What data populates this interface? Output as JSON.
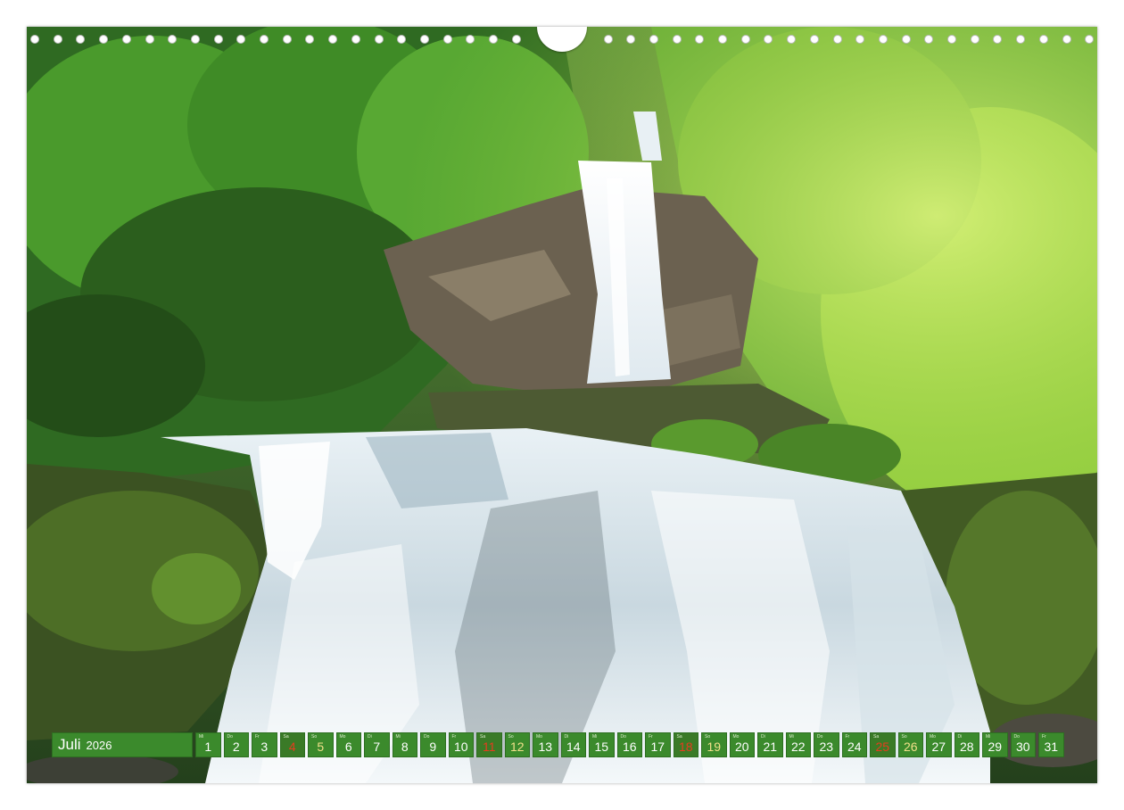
{
  "calendar": {
    "month": "Juli",
    "year": "2026",
    "days": [
      {
        "n": "1",
        "wd": "Mi",
        "kind": "weekday"
      },
      {
        "n": "2",
        "wd": "Do",
        "kind": "weekday"
      },
      {
        "n": "3",
        "wd": "Fr",
        "kind": "weekday"
      },
      {
        "n": "4",
        "wd": "Sa",
        "kind": "sun"
      },
      {
        "n": "5",
        "wd": "So",
        "kind": "sat"
      },
      {
        "n": "6",
        "wd": "Mo",
        "kind": "weekday"
      },
      {
        "n": "7",
        "wd": "Di",
        "kind": "weekday"
      },
      {
        "n": "8",
        "wd": "Mi",
        "kind": "weekday"
      },
      {
        "n": "9",
        "wd": "Do",
        "kind": "weekday"
      },
      {
        "n": "10",
        "wd": "Fr",
        "kind": "weekday"
      },
      {
        "n": "11",
        "wd": "Sa",
        "kind": "sun"
      },
      {
        "n": "12",
        "wd": "So",
        "kind": "sat"
      },
      {
        "n": "13",
        "wd": "Mo",
        "kind": "weekday"
      },
      {
        "n": "14",
        "wd": "Di",
        "kind": "weekday"
      },
      {
        "n": "15",
        "wd": "Mi",
        "kind": "weekday"
      },
      {
        "n": "16",
        "wd": "Do",
        "kind": "weekday"
      },
      {
        "n": "17",
        "wd": "Fr",
        "kind": "weekday"
      },
      {
        "n": "18",
        "wd": "Sa",
        "kind": "sun"
      },
      {
        "n": "19",
        "wd": "So",
        "kind": "sat"
      },
      {
        "n": "20",
        "wd": "Mo",
        "kind": "weekday"
      },
      {
        "n": "21",
        "wd": "Di",
        "kind": "weekday"
      },
      {
        "n": "22",
        "wd": "Mi",
        "kind": "weekday"
      },
      {
        "n": "23",
        "wd": "Do",
        "kind": "weekday"
      },
      {
        "n": "24",
        "wd": "Fr",
        "kind": "weekday"
      },
      {
        "n": "25",
        "wd": "Sa",
        "kind": "sun"
      },
      {
        "n": "26",
        "wd": "So",
        "kind": "sat"
      },
      {
        "n": "27",
        "wd": "Mo",
        "kind": "weekday"
      },
      {
        "n": "28",
        "wd": "Di",
        "kind": "weekday"
      },
      {
        "n": "29",
        "wd": "Mi",
        "kind": "weekday"
      },
      {
        "n": "30",
        "wd": "Do",
        "kind": "weekday"
      },
      {
        "n": "31",
        "wd": "Fr",
        "kind": "weekday"
      }
    ]
  },
  "photo": {
    "subject": "waterfall-in-forest-image"
  },
  "colors": {
    "strip_green": "#3b8a2c",
    "saturday_yellow": "#f2e08a",
    "sunday_red": "#e63c1e"
  }
}
